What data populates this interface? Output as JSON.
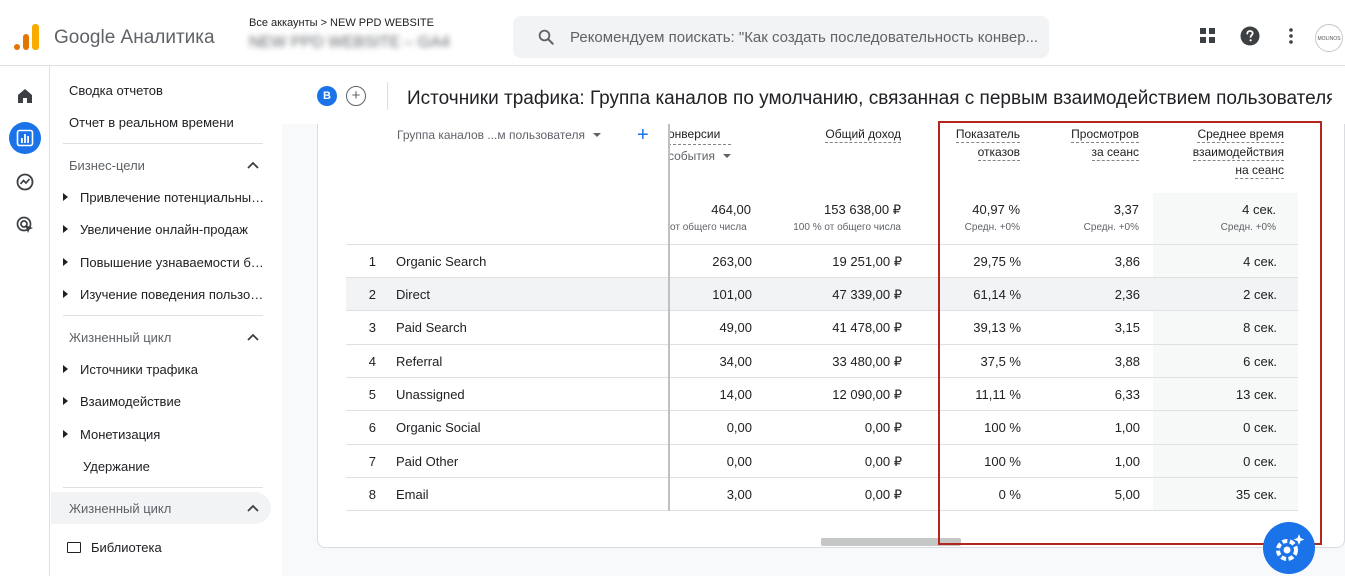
{
  "header": {
    "app_name": "Google Аналитика",
    "breadcrumb": "Все аккаунты > NEW PPD WEBSITE",
    "property_name": "NEW PPD WEBSITE – GA4",
    "search_placeholder": "Рекомендуем поискать: \"Как создать последовательность конвер...",
    "avatar_text": "MOLINOS"
  },
  "nav": {
    "reports_snapshot": "Сводка отчетов",
    "realtime": "Отчет в реальном времени",
    "section_business": "Бизнес-цели",
    "business_items": [
      "Привлечение потенциальных клиентов",
      "Увеличение онлайн-продаж",
      "Повышение узнаваемости бренда",
      "Изучение поведения пользователей"
    ],
    "section_lifecycle": "Жизненный цикл",
    "lifecycle_items": [
      "Источники трафика",
      "Взаимодействие",
      "Монетизация"
    ],
    "retention": "Удержание",
    "section_lifecycle_2": "Жизненный цикл",
    "library": "Библиотека"
  },
  "report": {
    "badge": "B",
    "title": "Источники трафика: Группа каналов по умолчанию, связанная с первым взаимодействием пользователя"
  },
  "table": {
    "dimension_header": "Группа каналов ...м пользователя",
    "col_conversions": [
      "онверсии",
      "события"
    ],
    "col_revenue": "Общий доход",
    "col_bounce": [
      "Показатель",
      "отказов"
    ],
    "col_views": [
      "Просмотров",
      "за сеанс"
    ],
    "col_time": [
      "Среднее время",
      "взаимодействия",
      "на сеанс"
    ],
    "totals": {
      "conversions": "464,00",
      "conversions_sub": "от общего числа",
      "revenue": "153 638,00 ₽",
      "revenue_sub": "100 % от общего числа",
      "bounce": "40,97 %",
      "bounce_sub": "Средн. +0%",
      "views": "3,37",
      "views_sub": "Средн. +0%",
      "time": "4 сек.",
      "time_sub": "Средн. +0%"
    },
    "rows": [
      {
        "idx": "1",
        "channel": "Organic Search",
        "conv": "263,00",
        "rev": "19 251,00 ₽",
        "bounce": "29,75 %",
        "views": "3,86",
        "time": "4 сек."
      },
      {
        "idx": "2",
        "channel": "Direct",
        "conv": "101,00",
        "rev": "47 339,00 ₽",
        "bounce": "61,14 %",
        "views": "2,36",
        "time": "2 сек."
      },
      {
        "idx": "3",
        "channel": "Paid Search",
        "conv": "49,00",
        "rev": "41 478,00 ₽",
        "bounce": "39,13 %",
        "views": "3,15",
        "time": "8 сек."
      },
      {
        "idx": "4",
        "channel": "Referral",
        "conv": "34,00",
        "rev": "33 480,00 ₽",
        "bounce": "37,5 %",
        "views": "3,88",
        "time": "6 сек."
      },
      {
        "idx": "5",
        "channel": "Unassigned",
        "conv": "14,00",
        "rev": "12 090,00 ₽",
        "bounce": "11,11 %",
        "views": "6,33",
        "time": "13 сек."
      },
      {
        "idx": "6",
        "channel": "Organic Social",
        "conv": "0,00",
        "rev": "0,00 ₽",
        "bounce": "100 %",
        "views": "1,00",
        "time": "0 сек."
      },
      {
        "idx": "7",
        "channel": "Paid Other",
        "conv": "0,00",
        "rev": "0,00 ₽",
        "bounce": "100 %",
        "views": "1,00",
        "time": "0 сек."
      },
      {
        "idx": "8",
        "channel": "Email",
        "conv": "3,00",
        "rev": "0,00 ₽",
        "bounce": "0 %",
        "views": "5,00",
        "time": "35 сек."
      }
    ]
  },
  "colors": {
    "accent": "#1a73e8",
    "highlight_box": "#b3261e",
    "row_highlight": "#f1f3f4"
  }
}
